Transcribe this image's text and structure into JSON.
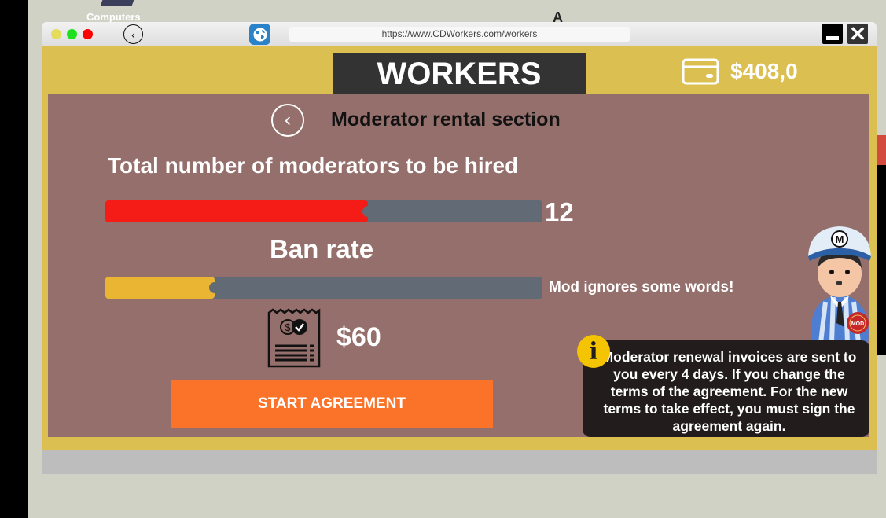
{
  "desktop": {
    "icon_label": "Computers",
    "mark": "A"
  },
  "browser": {
    "back_icon": "chevron-left-icon",
    "globe_icon": "globe-icon",
    "url": "https://www.CDWorkers.com/workers",
    "window_controls": [
      "minimize-icon",
      "close-icon"
    ],
    "traffic_lights": {
      "yellow": "#e6dc5c",
      "green": "#1ee01e",
      "red": "#ff0000"
    }
  },
  "header": {
    "title": "WORKERS",
    "wallet_icon": "credit-card-icon",
    "balance": "$408,0"
  },
  "panel": {
    "back_icon": "chevron-left-icon",
    "title": "Moderator rental section",
    "moderators": {
      "label": "Total number of moderators to be hired",
      "value": "12",
      "fill_fraction": 0.6,
      "color": "#f51c17"
    },
    "ban_rate": {
      "label": "Ban rate",
      "description": "Mod ignores some words!",
      "fill_fraction": 0.25,
      "color": "#ebb534"
    },
    "invoice_icon": "receipt-check-icon",
    "price": "$60",
    "start_button": "START AGREEMENT"
  },
  "info": {
    "icon": "info-icon",
    "message": "Moderator renewal invoices are sent to you every 4 days. If you change the terms of the agreement. For the new terms to take effect, you must sign the agreement again.",
    "mascot_badge": "MOD",
    "mascot_cap_letter": "M"
  },
  "colors": {
    "accent_yellow": "#dbbf50",
    "panel_bg": "#956f6c",
    "button_orange": "#fb7229",
    "slider_track": "#626a75"
  }
}
